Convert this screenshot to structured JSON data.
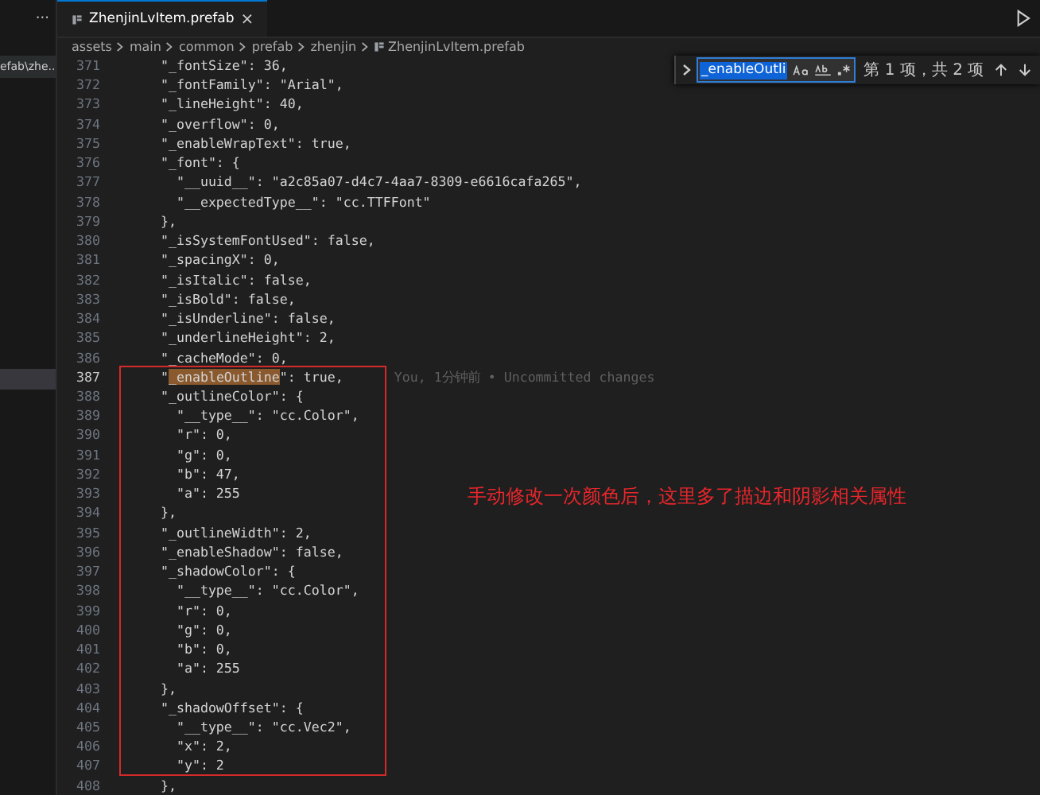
{
  "sidebar": {
    "more": "···",
    "items": [
      {
        "label": "efab\\zhe...",
        "selected": false
      }
    ]
  },
  "tabs": [
    {
      "label": "ZhenjinLvItem.prefab",
      "close": "×",
      "selected": true
    }
  ],
  "breadcrumb": [
    "assets",
    "main",
    "common",
    "prefab",
    "zhenjin",
    "ZhenjinLvItem.prefab"
  ],
  "find_widget": {
    "query": "_enableOutli",
    "status": "第 1 项，共 2 项"
  },
  "code_lines": [
    {
      "number": "371",
      "code": "      \"_fontSize\": 36,",
      "current": false
    },
    {
      "number": "372",
      "code": "      \"_fontFamily\": \"Arial\",",
      "current": false
    },
    {
      "number": "373",
      "code": "      \"_lineHeight\": 40,",
      "current": false
    },
    {
      "number": "374",
      "code": "      \"_overflow\": 0,",
      "current": false
    },
    {
      "number": "375",
      "code": "      \"_enableWrapText\": true,",
      "current": false
    },
    {
      "number": "376",
      "code": "      \"_font\": {",
      "current": false
    },
    {
      "number": "377",
      "code": "        \"__uuid__\": \"a2c85a07-d4c7-4aa7-8309-e6616cafa265\",",
      "current": false
    },
    {
      "number": "378",
      "code": "        \"__expectedType__\": \"cc.TTFFont\"",
      "current": false
    },
    {
      "number": "379",
      "code": "      },",
      "current": false
    },
    {
      "number": "380",
      "code": "      \"_isSystemFontUsed\": false,",
      "current": false
    },
    {
      "number": "381",
      "code": "      \"_spacingX\": 0,",
      "current": false
    },
    {
      "number": "382",
      "code": "      \"_isItalic\": false,",
      "current": false
    },
    {
      "number": "383",
      "code": "      \"_isBold\": false,",
      "current": false
    },
    {
      "number": "384",
      "code": "      \"_isUnderline\": false,",
      "current": false
    },
    {
      "number": "385",
      "code": "      \"_underlineHeight\": 2,",
      "current": false
    },
    {
      "number": "386",
      "code": "      \"_cacheMode\": 0,",
      "current": false
    },
    {
      "number": "387",
      "segments": [
        {
          "text": "      \"",
          "match": false
        },
        {
          "text": "_enableOutline",
          "match": true
        },
        {
          "text": "\": true,",
          "match": false
        }
      ],
      "blame": "You, 1分钟前 • Uncommitted changes",
      "current": true
    },
    {
      "number": "388",
      "code": "      \"_outlineColor\": {",
      "current": false
    },
    {
      "number": "389",
      "code": "        \"__type__\": \"cc.Color\",",
      "current": false
    },
    {
      "number": "390",
      "code": "        \"r\": 0,",
      "current": false
    },
    {
      "number": "391",
      "code": "        \"g\": 0,",
      "current": false
    },
    {
      "number": "392",
      "code": "        \"b\": 47,",
      "current": false
    },
    {
      "number": "393",
      "code": "        \"a\": 255",
      "current": false
    },
    {
      "number": "394",
      "code": "      },",
      "current": false
    },
    {
      "number": "395",
      "code": "      \"_outlineWidth\": 2,",
      "current": false
    },
    {
      "number": "396",
      "code": "      \"_enableShadow\": false,",
      "current": false
    },
    {
      "number": "397",
      "code": "      \"_shadowColor\": {",
      "current": false
    },
    {
      "number": "398",
      "code": "        \"__type__\": \"cc.Color\",",
      "current": false
    },
    {
      "number": "399",
      "code": "        \"r\": 0,",
      "current": false
    },
    {
      "number": "400",
      "code": "        \"g\": 0,",
      "current": false
    },
    {
      "number": "401",
      "code": "        \"b\": 0,",
      "current": false
    },
    {
      "number": "402",
      "code": "        \"a\": 255",
      "current": false
    },
    {
      "number": "403",
      "code": "      },",
      "current": false
    },
    {
      "number": "404",
      "code": "      \"_shadowOffset\": {",
      "current": false
    },
    {
      "number": "405",
      "code": "        \"__type__\": \"cc.Vec2\",",
      "current": false
    },
    {
      "number": "406",
      "code": "        \"x\": 2,",
      "current": false
    },
    {
      "number": "407",
      "code": "        \"y\": 2",
      "current": false
    },
    {
      "number": "408",
      "code": "      },",
      "current": false
    }
  ],
  "annotation": {
    "text": "手动修改一次颜色后，这里多了描边和阴影相关属性"
  }
}
